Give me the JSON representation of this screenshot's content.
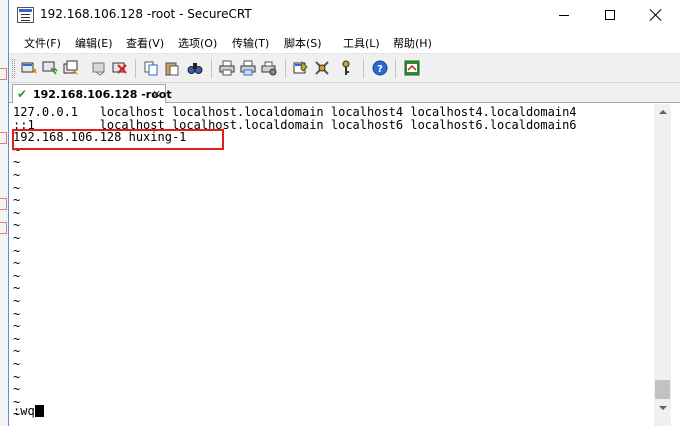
{
  "window": {
    "title": "192.168.106.128 -root - SecureCRT",
    "icon": "securecrt-icon"
  },
  "menu": [
    {
      "label": "文件(F)"
    },
    {
      "label": "编辑(E)"
    },
    {
      "label": "查看(V)"
    },
    {
      "label": "选项(O)"
    },
    {
      "label": "传输(T)"
    },
    {
      "label": "脚本(S)"
    },
    {
      "label": "工具(L)"
    },
    {
      "label": "帮助(H)"
    }
  ],
  "toolbar": {
    "icons": [
      "connect-icon",
      "quick-connect-icon",
      "connect-in-tab-icon",
      "reconnect-icon",
      "disconnect-icon",
      "copy-icon",
      "paste-icon",
      "find-icon",
      "print-icon",
      "print-selection-icon",
      "print-setup-icon",
      "session-options-icon",
      "global-options-icon",
      "key-map-icon",
      "help-icon",
      "sftp-icon"
    ]
  },
  "tab": {
    "label": "192.168.106.128 -root",
    "status_icon": "connected-check-icon",
    "close_glyph": "×"
  },
  "terminal": {
    "lines": [
      "127.0.0.1   localhost localhost.localdomain localhost4 localhost4.localdomain4",
      "::1         localhost localhost.localdomain localhost6 localhost6.localdomain6",
      "192.168.106.128 huxing-1",
      "~",
      "~",
      "~",
      "~",
      "~",
      "~",
      "~",
      "~",
      "~",
      "~",
      "~",
      "~",
      "~",
      "~",
      "~",
      "~",
      "~",
      "~",
      "~",
      "~",
      "~",
      "~"
    ],
    "command": ":wq",
    "highlighted_line": "192.168.106.128 huxing-1",
    "highlight_color": "#e01e1e"
  },
  "colors": {
    "background": "#ffffff",
    "accent": "#2a6ad0",
    "connected": "#2c9a2c"
  }
}
